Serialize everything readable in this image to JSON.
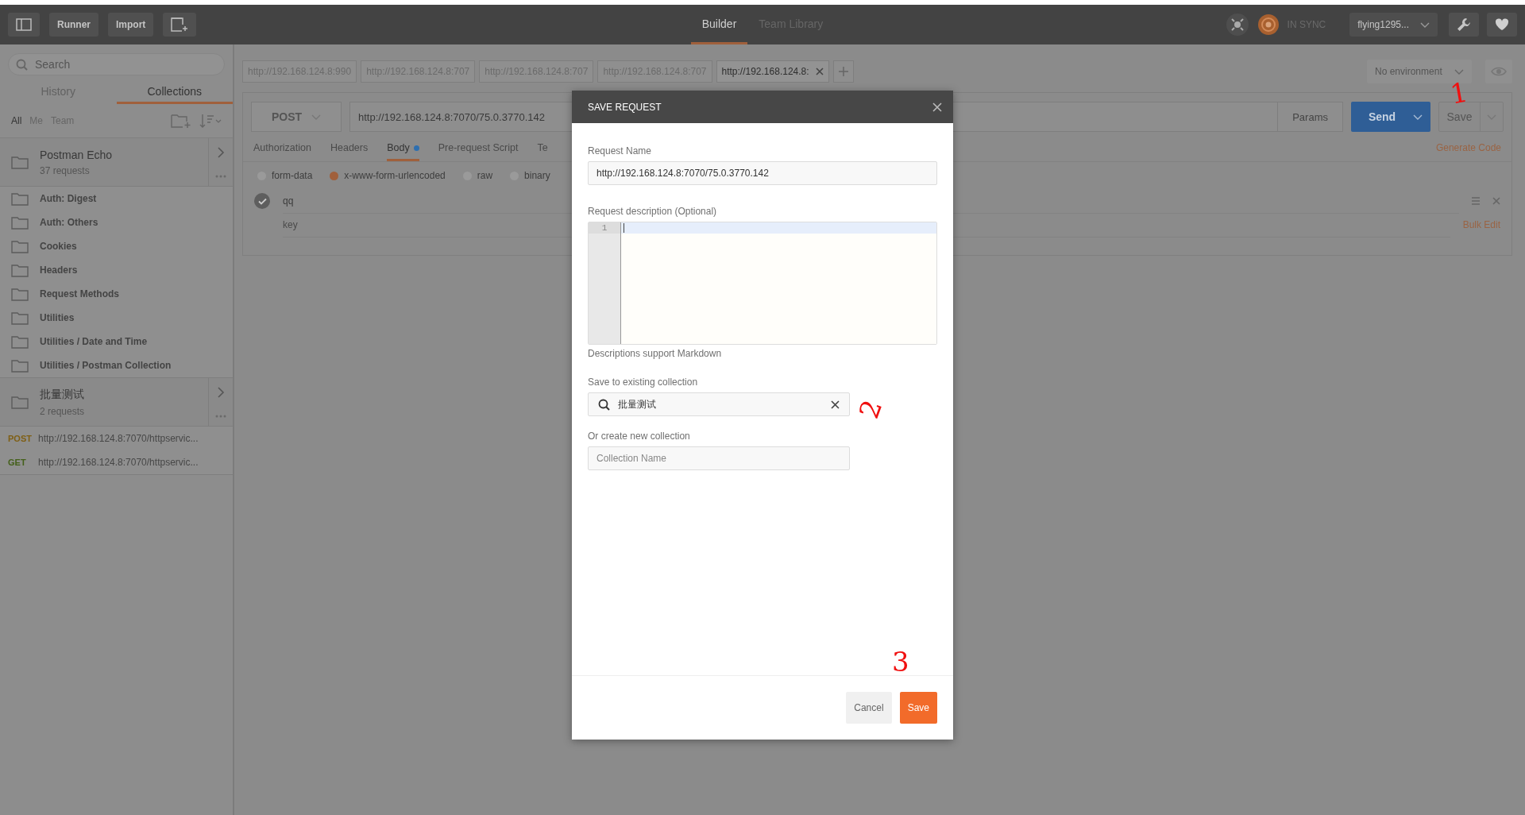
{
  "toolbar": {
    "buttons": [
      "Runner",
      "Import"
    ],
    "views": [
      {
        "label": "Builder",
        "selected": true
      },
      {
        "label": "Team Library",
        "selected": false
      }
    ],
    "sync_status": "IN SYNC",
    "user": "flying1295..."
  },
  "sidebar": {
    "search": {
      "placeholder": "Search"
    },
    "tabs": [
      {
        "label": "History",
        "selected": false
      },
      {
        "label": "Collections",
        "selected": true
      }
    ],
    "filters": [
      {
        "label": "All",
        "selected": true
      },
      {
        "label": "Me",
        "selected": false
      },
      {
        "label": "Team",
        "selected": false
      }
    ],
    "collections": [
      {
        "name": "Postman Echo",
        "count": "37 requests",
        "children": [
          {
            "kind": "folder",
            "name": "Auth: Digest"
          },
          {
            "kind": "folder",
            "name": "Auth: Others"
          },
          {
            "kind": "folder",
            "name": "Cookies"
          },
          {
            "kind": "folder",
            "name": "Headers"
          },
          {
            "kind": "folder",
            "name": "Request Methods"
          },
          {
            "kind": "folder",
            "name": "Utilities"
          },
          {
            "kind": "folder",
            "name": "Utilities / Date and Time"
          },
          {
            "kind": "folder",
            "name": "Utilities / Postman Collection"
          }
        ]
      },
      {
        "name": "批量测试",
        "count": "2 requests",
        "children": [
          {
            "kind": "request",
            "method": "POST",
            "color": "#7f5f14",
            "url": "http://192.168.124.8:7070/httpservic..."
          },
          {
            "kind": "request",
            "method": "GET",
            "color": "#44601a",
            "url": "http://192.168.124.8:7070/httpservic..."
          }
        ]
      }
    ]
  },
  "request_tabs": [
    {
      "label": "http://192.168.124.8:990",
      "selected": false
    },
    {
      "label": "http://192.168.124.8:707",
      "selected": false
    },
    {
      "label": "http://192.168.124.8:707",
      "selected": false
    },
    {
      "label": "http://192.168.124.8:707",
      "selected": false
    },
    {
      "label": "http://192.168.124.8:",
      "selected": true
    }
  ],
  "environment": "No environment",
  "request": {
    "method": "POST",
    "url": "http://192.168.124.8:7070/75.0.3770.142",
    "params_button": "Params",
    "send_button": "Send",
    "save_button": "Save",
    "generate_code": "Generate Code",
    "tabs": [
      {
        "label": "Authorization",
        "selected": false,
        "indicator": false
      },
      {
        "label": "Headers",
        "selected": false,
        "indicator": false
      },
      {
        "label": "Body",
        "selected": true,
        "indicator": true
      },
      {
        "label": "Pre-request Script",
        "selected": false,
        "indicator": false
      },
      {
        "label": "Te",
        "selected": false,
        "indicator": false
      }
    ],
    "body_modes": [
      {
        "label": "form-data",
        "selected": false
      },
      {
        "label": "x-www-form-urlencoded",
        "selected": true
      },
      {
        "label": "raw",
        "selected": false
      },
      {
        "label": "binary",
        "selected": false
      }
    ],
    "params": [
      {
        "key": "qq",
        "checked": true
      }
    ],
    "key_placeholder": "key",
    "bulk_edit": "Bulk Edit"
  },
  "dialog": {
    "title": "SAVE REQUEST",
    "name_label": "Request Name",
    "name_value": "http://192.168.124.8:7070/75.0.3770.142",
    "description_label": "Request description (Optional)",
    "line_numbers": [
      "1"
    ],
    "markdown_note": "Descriptions support Markdown",
    "existing_label": "Save to existing collection",
    "existing_value": "批量测试",
    "new_label": "Or create new collection",
    "new_placeholder": "Collection Name",
    "buttons": [
      {
        "label": "Cancel",
        "kind": "secondary"
      },
      {
        "label": "Save",
        "kind": "primary"
      }
    ]
  },
  "annotations": [
    {
      "text": "1"
    },
    {
      "text": "2"
    },
    {
      "text": "3"
    }
  ]
}
